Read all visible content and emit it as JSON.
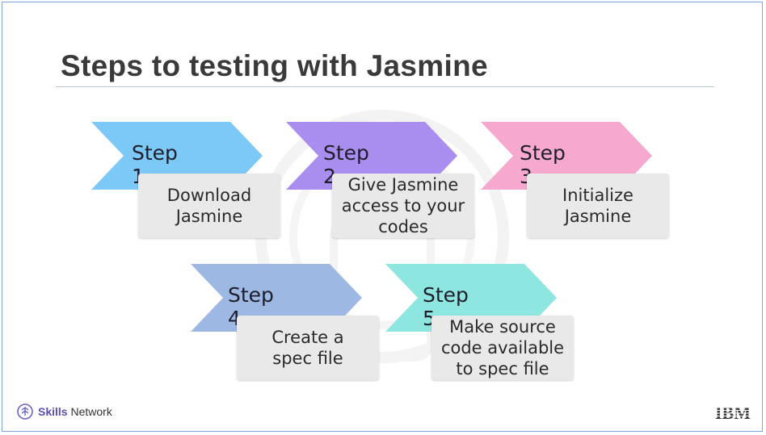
{
  "slide": {
    "title": "Steps to testing with Jasmine"
  },
  "steps": [
    {
      "label": "Step 1",
      "description": "Download\nJasmine",
      "color": "#7cc8f7"
    },
    {
      "label": "Step 2",
      "description": "Give Jasmine\naccess to your\ncodes",
      "color": "#a98ef0"
    },
    {
      "label": "Step 3",
      "description": "Initialize\nJasmine",
      "color": "#f7a8cf"
    },
    {
      "label": "Step 4",
      "description": "Create a\nspec file",
      "color": "#9cb8e3"
    },
    {
      "label": "Step 5",
      "description": "Make source\ncode available\nto spec file",
      "color": "#8ee6e1"
    }
  ],
  "footer": {
    "brand_bold": "Skills",
    "brand_rest": " Network",
    "brand_icon": "skills-network-icon",
    "company_logo_text": "IBM"
  }
}
